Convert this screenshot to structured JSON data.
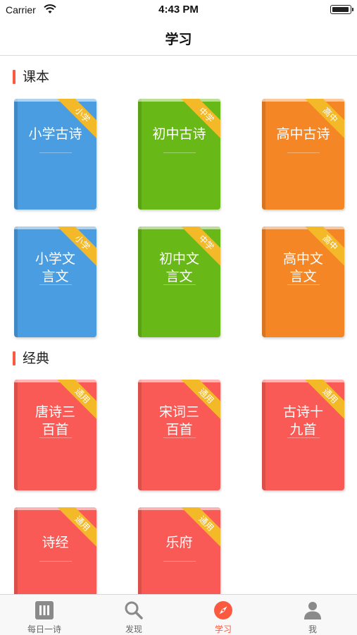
{
  "status_bar": {
    "carrier": "Carrier",
    "time": "4:43 PM"
  },
  "nav": {
    "title": "学习"
  },
  "sections": [
    {
      "title": "课本"
    },
    {
      "title": "经典"
    }
  ],
  "textbooks": [
    {
      "title": "小学古诗",
      "ribbon": "小学",
      "color": "#4a9de0"
    },
    {
      "title": "初中古诗",
      "ribbon": "中学",
      "color": "#68b817"
    },
    {
      "title": "高中古诗",
      "ribbon": "高中",
      "color": "#f58626"
    },
    {
      "title": "小学文\n言文",
      "ribbon": "小学",
      "color": "#4a9de0"
    },
    {
      "title": "初中文\n言文",
      "ribbon": "中学",
      "color": "#68b817"
    },
    {
      "title": "高中文\n言文",
      "ribbon": "高中",
      "color": "#f58626"
    }
  ],
  "classics": [
    {
      "title": "唐诗三\n百首",
      "ribbon": "通用",
      "color": "#fa5a55"
    },
    {
      "title": "宋词三\n百首",
      "ribbon": "通用",
      "color": "#fa5a55"
    },
    {
      "title": "古诗十\n九首",
      "ribbon": "通用",
      "color": "#fa5a55"
    },
    {
      "title": "诗经",
      "ribbon": "通用",
      "color": "#fa5a55"
    },
    {
      "title": "乐府",
      "ribbon": "通用",
      "color": "#fa5a55"
    }
  ],
  "tabs": [
    {
      "label": "每日一诗",
      "icon": "calendar-icon",
      "active": false
    },
    {
      "label": "发现",
      "icon": "search-icon",
      "active": false
    },
    {
      "label": "学习",
      "icon": "compass-icon",
      "active": true
    },
    {
      "label": "我",
      "icon": "person-icon",
      "active": false
    }
  ],
  "colors": {
    "accent": "#fb5a41",
    "ribbon": "#f4b929",
    "tab_inactive": "#666666"
  }
}
